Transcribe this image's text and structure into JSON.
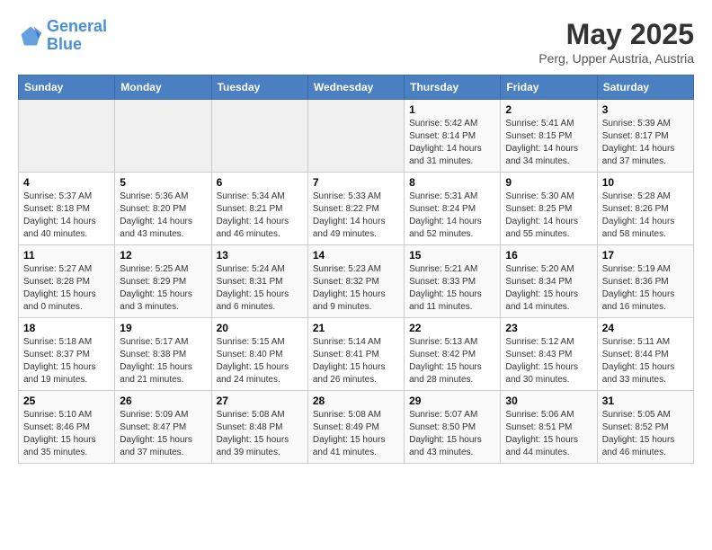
{
  "logo": {
    "line1": "General",
    "line2": "Blue"
  },
  "title": "May 2025",
  "subtitle": "Perg, Upper Austria, Austria",
  "weekdays": [
    "Sunday",
    "Monday",
    "Tuesday",
    "Wednesday",
    "Thursday",
    "Friday",
    "Saturday"
  ],
  "weeks": [
    [
      {
        "day": "",
        "info": ""
      },
      {
        "day": "",
        "info": ""
      },
      {
        "day": "",
        "info": ""
      },
      {
        "day": "",
        "info": ""
      },
      {
        "day": "1",
        "info": "Sunrise: 5:42 AM\nSunset: 8:14 PM\nDaylight: 14 hours\nand 31 minutes."
      },
      {
        "day": "2",
        "info": "Sunrise: 5:41 AM\nSunset: 8:15 PM\nDaylight: 14 hours\nand 34 minutes."
      },
      {
        "day": "3",
        "info": "Sunrise: 5:39 AM\nSunset: 8:17 PM\nDaylight: 14 hours\nand 37 minutes."
      }
    ],
    [
      {
        "day": "4",
        "info": "Sunrise: 5:37 AM\nSunset: 8:18 PM\nDaylight: 14 hours\nand 40 minutes."
      },
      {
        "day": "5",
        "info": "Sunrise: 5:36 AM\nSunset: 8:20 PM\nDaylight: 14 hours\nand 43 minutes."
      },
      {
        "day": "6",
        "info": "Sunrise: 5:34 AM\nSunset: 8:21 PM\nDaylight: 14 hours\nand 46 minutes."
      },
      {
        "day": "7",
        "info": "Sunrise: 5:33 AM\nSunset: 8:22 PM\nDaylight: 14 hours\nand 49 minutes."
      },
      {
        "day": "8",
        "info": "Sunrise: 5:31 AM\nSunset: 8:24 PM\nDaylight: 14 hours\nand 52 minutes."
      },
      {
        "day": "9",
        "info": "Sunrise: 5:30 AM\nSunset: 8:25 PM\nDaylight: 14 hours\nand 55 minutes."
      },
      {
        "day": "10",
        "info": "Sunrise: 5:28 AM\nSunset: 8:26 PM\nDaylight: 14 hours\nand 58 minutes."
      }
    ],
    [
      {
        "day": "11",
        "info": "Sunrise: 5:27 AM\nSunset: 8:28 PM\nDaylight: 15 hours\nand 0 minutes."
      },
      {
        "day": "12",
        "info": "Sunrise: 5:25 AM\nSunset: 8:29 PM\nDaylight: 15 hours\nand 3 minutes."
      },
      {
        "day": "13",
        "info": "Sunrise: 5:24 AM\nSunset: 8:31 PM\nDaylight: 15 hours\nand 6 minutes."
      },
      {
        "day": "14",
        "info": "Sunrise: 5:23 AM\nSunset: 8:32 PM\nDaylight: 15 hours\nand 9 minutes."
      },
      {
        "day": "15",
        "info": "Sunrise: 5:21 AM\nSunset: 8:33 PM\nDaylight: 15 hours\nand 11 minutes."
      },
      {
        "day": "16",
        "info": "Sunrise: 5:20 AM\nSunset: 8:34 PM\nDaylight: 15 hours\nand 14 minutes."
      },
      {
        "day": "17",
        "info": "Sunrise: 5:19 AM\nSunset: 8:36 PM\nDaylight: 15 hours\nand 16 minutes."
      }
    ],
    [
      {
        "day": "18",
        "info": "Sunrise: 5:18 AM\nSunset: 8:37 PM\nDaylight: 15 hours\nand 19 minutes."
      },
      {
        "day": "19",
        "info": "Sunrise: 5:17 AM\nSunset: 8:38 PM\nDaylight: 15 hours\nand 21 minutes."
      },
      {
        "day": "20",
        "info": "Sunrise: 5:15 AM\nSunset: 8:40 PM\nDaylight: 15 hours\nand 24 minutes."
      },
      {
        "day": "21",
        "info": "Sunrise: 5:14 AM\nSunset: 8:41 PM\nDaylight: 15 hours\nand 26 minutes."
      },
      {
        "day": "22",
        "info": "Sunrise: 5:13 AM\nSunset: 8:42 PM\nDaylight: 15 hours\nand 28 minutes."
      },
      {
        "day": "23",
        "info": "Sunrise: 5:12 AM\nSunset: 8:43 PM\nDaylight: 15 hours\nand 30 minutes."
      },
      {
        "day": "24",
        "info": "Sunrise: 5:11 AM\nSunset: 8:44 PM\nDaylight: 15 hours\nand 33 minutes."
      }
    ],
    [
      {
        "day": "25",
        "info": "Sunrise: 5:10 AM\nSunset: 8:46 PM\nDaylight: 15 hours\nand 35 minutes."
      },
      {
        "day": "26",
        "info": "Sunrise: 5:09 AM\nSunset: 8:47 PM\nDaylight: 15 hours\nand 37 minutes."
      },
      {
        "day": "27",
        "info": "Sunrise: 5:08 AM\nSunset: 8:48 PM\nDaylight: 15 hours\nand 39 minutes."
      },
      {
        "day": "28",
        "info": "Sunrise: 5:08 AM\nSunset: 8:49 PM\nDaylight: 15 hours\nand 41 minutes."
      },
      {
        "day": "29",
        "info": "Sunrise: 5:07 AM\nSunset: 8:50 PM\nDaylight: 15 hours\nand 43 minutes."
      },
      {
        "day": "30",
        "info": "Sunrise: 5:06 AM\nSunset: 8:51 PM\nDaylight: 15 hours\nand 44 minutes."
      },
      {
        "day": "31",
        "info": "Sunrise: 5:05 AM\nSunset: 8:52 PM\nDaylight: 15 hours\nand 46 minutes."
      }
    ]
  ]
}
